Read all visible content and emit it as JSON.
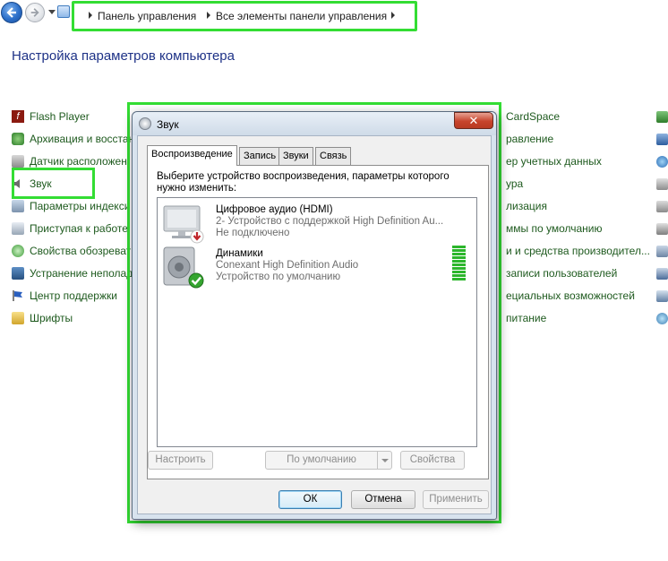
{
  "breadcrumb": {
    "items": [
      "Панель управления",
      "Все элементы панели управления"
    ]
  },
  "page": {
    "title": "Настройка параметров компьютера"
  },
  "control_panel": {
    "left_column": [
      {
        "label": "Flash Player",
        "icon": "flash-player-icon"
      },
      {
        "label": "Архивация и восстан",
        "icon": "backup-icon"
      },
      {
        "label": "Датчик расположен",
        "icon": "location-sensor-icon"
      },
      {
        "label": "Звук",
        "icon": "speaker-icon"
      },
      {
        "label": "Параметры индекси",
        "icon": "indexing-icon"
      },
      {
        "label": "Приступая к работе",
        "icon": "getting-started-icon"
      },
      {
        "label": "Свойства обозреват",
        "icon": "internet-options-icon"
      },
      {
        "label": "Устранение неполад",
        "icon": "troubleshooting-icon"
      },
      {
        "label": "Центр поддержки",
        "icon": "action-center-icon"
      },
      {
        "label": "Шрифты",
        "icon": "fonts-icon"
      }
    ],
    "right_column": [
      "CardSpace",
      "равление",
      "ер учетных данных",
      "ура",
      "лизация",
      "ммы по умолчанию",
      "и и средства производител...",
      "записи пользователей",
      "ециальных возможностей",
      "питание"
    ]
  },
  "dialog": {
    "title": "Звук",
    "close_label": "✕",
    "tabs": [
      "Воспроизведение",
      "Запись",
      "Звуки",
      "Связь"
    ],
    "active_tab": "Воспроизведение",
    "instruction": "Выберите устройство воспроизведения, параметры которого нужно изменить:",
    "devices": [
      {
        "name": "Цифровое аудио (HDMI)",
        "description": "2- Устройство с поддержкой High Definition Au...",
        "status": "Не подключено",
        "icon": "hdmi-monitor-icon",
        "badge": "disconnected-badge-icon"
      },
      {
        "name": "Динамики",
        "description": "Conexant High Definition Audio",
        "status": "Устройство по умолчанию",
        "icon": "speakers-device-icon",
        "badge": "default-check-badge-icon",
        "level_fraction": 1.0
      }
    ],
    "buttons": {
      "configure": "Настроить",
      "set_default": "По умолчанию",
      "properties": "Свойства",
      "ok": "ОК",
      "cancel": "Отмена",
      "apply": "Применить"
    }
  },
  "colors": {
    "highlight": "#33dd33",
    "link_green": "#1e5a1e",
    "title_blue": "#1e3287",
    "meter_green": "#2cb62c",
    "close_red": "#c7432b"
  }
}
